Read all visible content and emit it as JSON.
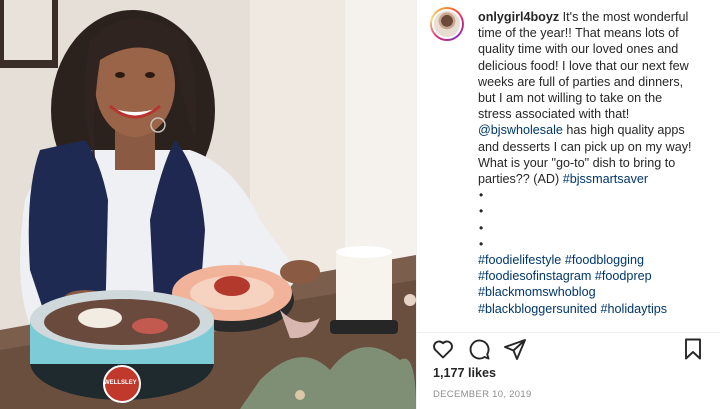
{
  "post": {
    "username": "onlygirl4boyz",
    "caption_lines": [
      "It's the most wonderful",
      "time of the year!! That means lots of",
      "quality time with our loved ones and",
      "delicious food! I love that our next few",
      "weeks are full of parties and dinners,",
      "but I am not willing to take on the",
      "stress associated with that!"
    ],
    "mention": "@bjswholesale",
    "mention_text": " has high quality apps",
    "caption_lines_2": [
      "and desserts I can pick up on my way!",
      "What is your \"go-to\" dish to bring to",
      "parties?? (AD) "
    ],
    "inline_tag": "#bjssmartsaver",
    "dot": "•",
    "hashtags": [
      [
        "#foodielifestyle",
        "#foodblogging"
      ],
      [
        "#foodiesofinstagram",
        "#foodprep"
      ],
      [
        "#blackmomswhoblog"
      ],
      [
        "#blackbloggersunited",
        "#holidaytips"
      ]
    ],
    "likes": "1,177 likes",
    "date": "DECEMBER 10, 2019"
  },
  "photo": {
    "tray_brand": "WELLSLEY"
  },
  "colors": {
    "link": "#00376b",
    "text": "#262626",
    "muted": "#8e8e8e"
  },
  "icons": [
    "heart-icon",
    "comment-icon",
    "share-icon",
    "bookmark-icon"
  ]
}
